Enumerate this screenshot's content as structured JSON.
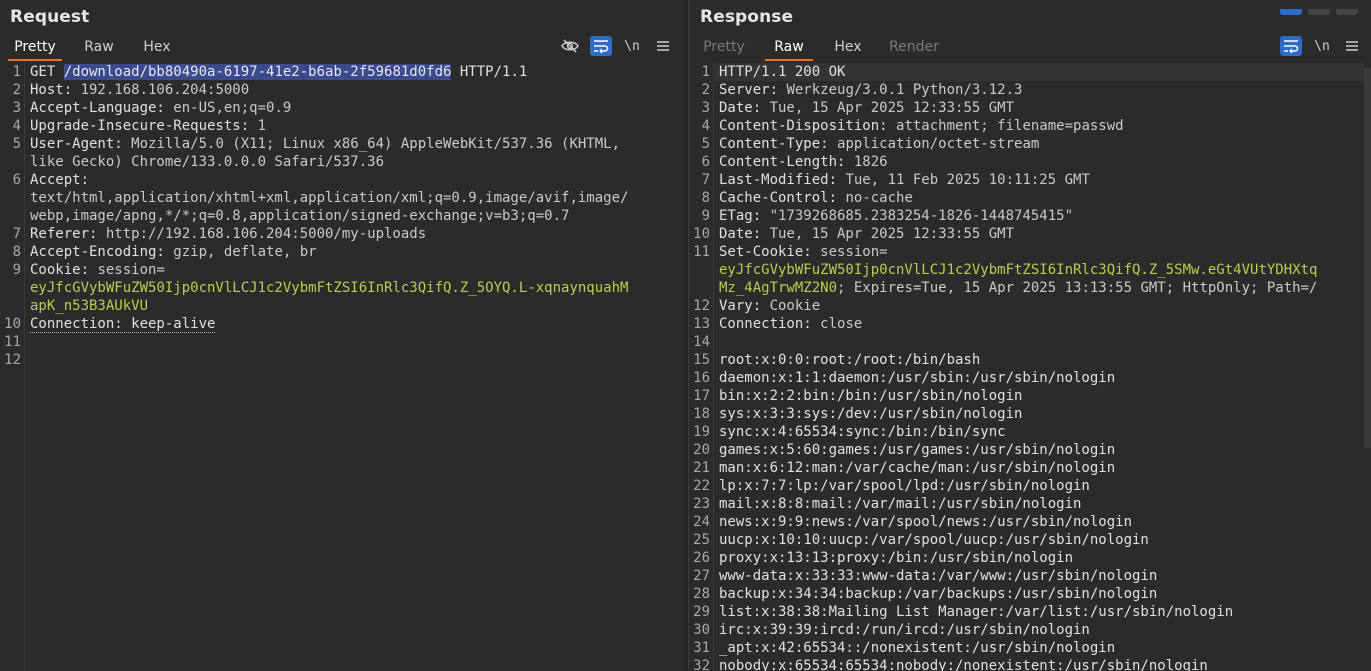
{
  "request": {
    "title": "Request",
    "tabs": [
      {
        "label": "Pretty",
        "active": true
      },
      {
        "label": "Raw",
        "active": false
      },
      {
        "label": "Hex",
        "active": false
      }
    ],
    "tools": {
      "newline": "\\n"
    },
    "lines": [
      {
        "n": "1",
        "parts": [
          {
            "t": "GET ",
            "c": "k"
          },
          {
            "t": "/download/bb80490a-6197-41e2-b6ab-2f59681d0fd6",
            "c": "sel"
          },
          {
            "t": " HTTP/1.1",
            "c": "k"
          }
        ]
      },
      {
        "n": "2",
        "parts": [
          {
            "t": "Host: ",
            "c": "k"
          },
          {
            "t": "192.168.106.204:5000",
            "c": "v"
          }
        ]
      },
      {
        "n": "3",
        "parts": [
          {
            "t": "Accept-Language: ",
            "c": "k"
          },
          {
            "t": "en-US,en;q=0.9",
            "c": "v"
          }
        ]
      },
      {
        "n": "4",
        "parts": [
          {
            "t": "Upgrade-Insecure-Requests: ",
            "c": "k"
          },
          {
            "t": "1",
            "c": "v"
          }
        ]
      },
      {
        "n": "5",
        "parts": [
          {
            "t": "User-Agent: ",
            "c": "k"
          },
          {
            "t": "Mozilla/5.0 (X11; Linux x86_64) AppleWebKit/537.36 (KHTML,",
            "c": "v"
          }
        ]
      },
      {
        "n": "",
        "parts": [
          {
            "t": "like Gecko) Chrome/133.0.0.0 Safari/537.36",
            "c": "v"
          }
        ]
      },
      {
        "n": "6",
        "parts": [
          {
            "t": "Accept: ",
            "c": "k"
          }
        ]
      },
      {
        "n": "",
        "parts": [
          {
            "t": "text/html,application/xhtml+xml,application/xml;q=0.9,image/avif,image/",
            "c": "v"
          }
        ]
      },
      {
        "n": "",
        "parts": [
          {
            "t": "webp,image/apng,*/*;q=0.8,application/signed-exchange;v=b3;q=0.7",
            "c": "v"
          }
        ]
      },
      {
        "n": "7",
        "parts": [
          {
            "t": "Referer: ",
            "c": "k"
          },
          {
            "t": "http://192.168.106.204:5000/my-uploads",
            "c": "v"
          }
        ]
      },
      {
        "n": "8",
        "parts": [
          {
            "t": "Accept-Encoding: ",
            "c": "k"
          },
          {
            "t": "gzip, deflate, br",
            "c": "v"
          }
        ]
      },
      {
        "n": "9",
        "parts": [
          {
            "t": "Cookie: ",
            "c": "k"
          },
          {
            "t": "session=",
            "c": "v"
          }
        ]
      },
      {
        "n": "",
        "parts": [
          {
            "t": "eyJfcGVybWFuZW50Ijp0cnVlLCJ1c2VybmFtZSI6InRlc3QifQ.Z_5OYQ.L-xqnaynquahM",
            "c": "g"
          }
        ]
      },
      {
        "n": "",
        "parts": [
          {
            "t": "apK_n53B3AUkVU",
            "c": "g"
          }
        ]
      },
      {
        "n": "10",
        "parts": [
          {
            "t": "Connection: keep-alive",
            "c": "k dotted"
          }
        ]
      },
      {
        "n": "11",
        "parts": []
      },
      {
        "n": "12",
        "parts": []
      }
    ]
  },
  "response": {
    "title": "Response",
    "tabs": [
      {
        "label": "Pretty",
        "active": false,
        "disabled": true
      },
      {
        "label": "Raw",
        "active": true
      },
      {
        "label": "Hex",
        "active": false
      },
      {
        "label": "Render",
        "active": false,
        "disabled": true
      }
    ],
    "tools": {
      "newline": "\\n"
    },
    "lines": [
      {
        "n": "1",
        "parts": [
          {
            "t": "HTTP/1.1 200 OK",
            "c": "k"
          }
        ]
      },
      {
        "n": "2",
        "parts": [
          {
            "t": "Server: ",
            "c": "k"
          },
          {
            "t": "Werkzeug/3.0.1 Python/3.12.3",
            "c": "v"
          }
        ]
      },
      {
        "n": "3",
        "parts": [
          {
            "t": "Date: ",
            "c": "k"
          },
          {
            "t": "Tue, 15 Apr 2025 12:33:55 GMT",
            "c": "v"
          }
        ]
      },
      {
        "n": "4",
        "parts": [
          {
            "t": "Content-Disposition: ",
            "c": "k"
          },
          {
            "t": "attachment; filename=passwd",
            "c": "v"
          }
        ]
      },
      {
        "n": "5",
        "parts": [
          {
            "t": "Content-Type: ",
            "c": "k"
          },
          {
            "t": "application/octet-stream",
            "c": "v"
          }
        ]
      },
      {
        "n": "6",
        "parts": [
          {
            "t": "Content-Length: ",
            "c": "k"
          },
          {
            "t": "1826",
            "c": "v"
          }
        ]
      },
      {
        "n": "7",
        "parts": [
          {
            "t": "Last-Modified: ",
            "c": "k"
          },
          {
            "t": "Tue, 11 Feb 2025 10:11:25 GMT",
            "c": "v"
          }
        ]
      },
      {
        "n": "8",
        "parts": [
          {
            "t": "Cache-Control: ",
            "c": "k"
          },
          {
            "t": "no-cache",
            "c": "v"
          }
        ]
      },
      {
        "n": "9",
        "parts": [
          {
            "t": "ETag: ",
            "c": "k"
          },
          {
            "t": "\"1739268685.2383254-1826-1448745415\"",
            "c": "v"
          }
        ]
      },
      {
        "n": "10",
        "parts": [
          {
            "t": "Date: ",
            "c": "k"
          },
          {
            "t": "Tue, 15 Apr 2025 12:33:55 GMT",
            "c": "v"
          }
        ]
      },
      {
        "n": "11",
        "parts": [
          {
            "t": "Set-Cookie: ",
            "c": "k"
          },
          {
            "t": "session=",
            "c": "v"
          }
        ]
      },
      {
        "n": "",
        "parts": [
          {
            "t": "eyJfcGVybWFuZW50Ijp0cnVlLCJ1c2VybmFtZSI6InRlc3QifQ.Z_5SMw.eGt4VUtYDHXtq",
            "c": "g"
          }
        ]
      },
      {
        "n": "",
        "parts": [
          {
            "t": "Mz_4AgTrwMZ2N0",
            "c": "g"
          },
          {
            "t": "; Expires=Tue, 15 Apr 2025 13:13:55 GMT; HttpOnly; Path=/",
            "c": "v"
          }
        ]
      },
      {
        "n": "12",
        "parts": [
          {
            "t": "Vary: ",
            "c": "k"
          },
          {
            "t": "Cookie",
            "c": "v"
          }
        ]
      },
      {
        "n": "13",
        "parts": [
          {
            "t": "Connection: ",
            "c": "k"
          },
          {
            "t": "close",
            "c": "v"
          }
        ]
      },
      {
        "n": "14",
        "parts": []
      },
      {
        "n": "15",
        "parts": [
          {
            "t": "root:x:0:0:root:/root:/bin/bash",
            "c": "k"
          }
        ]
      },
      {
        "n": "16",
        "parts": [
          {
            "t": "daemon:x:1:1:daemon:/usr/sbin:/usr/sbin/nologin",
            "c": "k"
          }
        ]
      },
      {
        "n": "17",
        "parts": [
          {
            "t": "bin:x:2:2:bin:/bin:/usr/sbin/nologin",
            "c": "k"
          }
        ]
      },
      {
        "n": "18",
        "parts": [
          {
            "t": "sys:x:3:3:sys:/dev:/usr/sbin/nologin",
            "c": "k"
          }
        ]
      },
      {
        "n": "19",
        "parts": [
          {
            "t": "sync:x:4:65534:sync:/bin:/bin/sync",
            "c": "k"
          }
        ]
      },
      {
        "n": "20",
        "parts": [
          {
            "t": "games:x:5:60:games:/usr/games:/usr/sbin/nologin",
            "c": "k"
          }
        ]
      },
      {
        "n": "21",
        "parts": [
          {
            "t": "man:x:6:12:man:/var/cache/man:/usr/sbin/nologin",
            "c": "k"
          }
        ]
      },
      {
        "n": "22",
        "parts": [
          {
            "t": "lp:x:7:7:lp:/var/spool/lpd:/usr/sbin/nologin",
            "c": "k"
          }
        ]
      },
      {
        "n": "23",
        "parts": [
          {
            "t": "mail:x:8:8:mail:/var/mail:/usr/sbin/nologin",
            "c": "k"
          }
        ]
      },
      {
        "n": "24",
        "parts": [
          {
            "t": "news:x:9:9:news:/var/spool/news:/usr/sbin/nologin",
            "c": "k"
          }
        ]
      },
      {
        "n": "25",
        "parts": [
          {
            "t": "uucp:x:10:10:uucp:/var/spool/uucp:/usr/sbin/nologin",
            "c": "k"
          }
        ]
      },
      {
        "n": "26",
        "parts": [
          {
            "t": "proxy:x:13:13:proxy:/bin:/usr/sbin/nologin",
            "c": "k"
          }
        ]
      },
      {
        "n": "27",
        "parts": [
          {
            "t": "www-data:x:33:33:www-data:/var/www:/usr/sbin/nologin",
            "c": "k"
          }
        ]
      },
      {
        "n": "28",
        "parts": [
          {
            "t": "backup:x:34:34:backup:/var/backups:/usr/sbin/nologin",
            "c": "k"
          }
        ]
      },
      {
        "n": "29",
        "parts": [
          {
            "t": "list:x:38:38:Mailing List Manager:/var/list:/usr/sbin/nologin",
            "c": "k"
          }
        ]
      },
      {
        "n": "30",
        "parts": [
          {
            "t": "irc:x:39:39:ircd:/run/ircd:/usr/sbin/nologin",
            "c": "k"
          }
        ]
      },
      {
        "n": "31",
        "parts": [
          {
            "t": "_apt:x:42:65534::/nonexistent:/usr/sbin/nologin",
            "c": "k"
          }
        ]
      },
      {
        "n": "32",
        "parts": [
          {
            "t": "nobody:x:65534:65534:nobody:/nonexistent:/usr/sbin/nologin",
            "c": "k"
          }
        ]
      }
    ]
  },
  "colors": {
    "accent_tab": "#e8732d",
    "toggle_on": "#2f6cc9",
    "selection": "#3a4a8c",
    "cookie_value": "#b5d14b"
  }
}
